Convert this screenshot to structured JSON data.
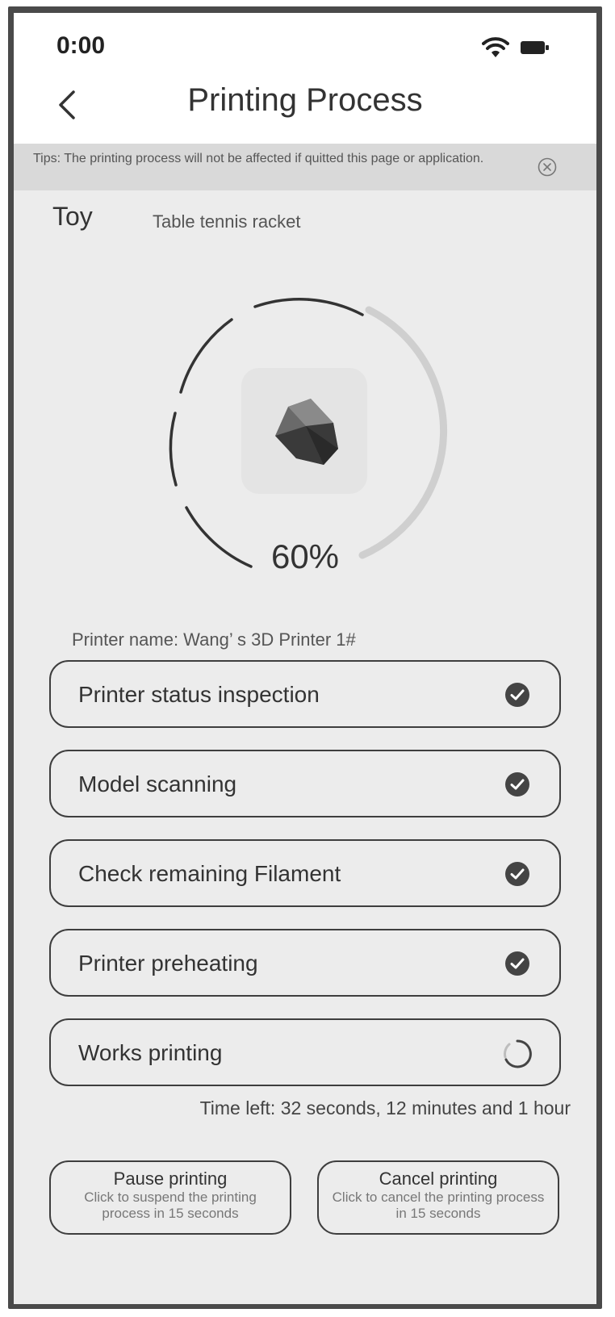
{
  "status_bar": {
    "time": "0:00"
  },
  "header": {
    "title": "Printing Process"
  },
  "tips": {
    "text": "Tips: The printing process will not be affected if quitted this page or application."
  },
  "model": {
    "category": "Toy",
    "name": "Table tennis racket"
  },
  "progress": {
    "percent_label": "60%",
    "value": 0.6
  },
  "printer": {
    "name_label": "Printer name: Wang’ s 3D Printer 1#"
  },
  "steps": [
    {
      "label": "Printer status inspection",
      "status": "done"
    },
    {
      "label": "Model scanning",
      "status": "done"
    },
    {
      "label": "Check remaining Filament",
      "status": "done"
    },
    {
      "label": "Printer preheating",
      "status": "done"
    },
    {
      "label": "Works printing",
      "status": "in-progress"
    }
  ],
  "time_left": "Time left: 32 seconds, 12 minutes and 1 hour",
  "actions": {
    "pause": {
      "title": "Pause printing",
      "subtitle": "Click to suspend the printing process in 15 seconds"
    },
    "cancel": {
      "title": "Cancel printing",
      "subtitle": "Click to cancel the printing process in 15 seconds"
    }
  },
  "icons": {
    "status": "check-circle-icon",
    "loading": "spinner-icon",
    "back": "chevron-left-icon",
    "close": "close-circle-icon"
  },
  "colors": {
    "background": "#ececec",
    "outline": "#3e3e3e",
    "check_fill": "#444444",
    "ring_track": "#cfcfcf"
  }
}
